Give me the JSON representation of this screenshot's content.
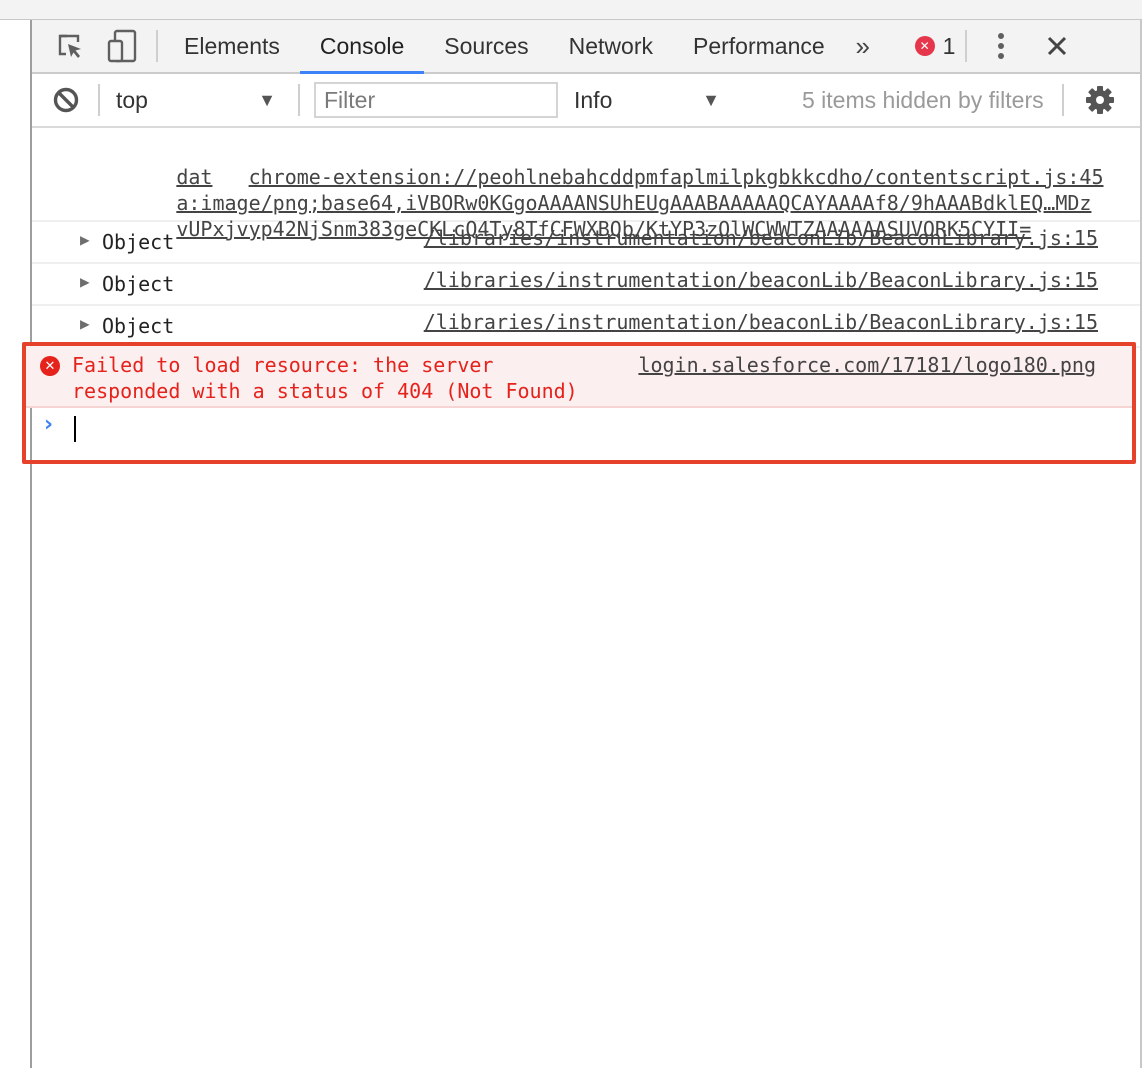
{
  "tabs": [
    {
      "label": "Elements",
      "active": false
    },
    {
      "label": "Console",
      "active": true
    },
    {
      "label": "Sources",
      "active": false
    },
    {
      "label": "Network",
      "active": false
    },
    {
      "label": "Performance",
      "active": false
    }
  ],
  "tabbar": {
    "more_tabs_icon": "»",
    "error_count": "1",
    "kebab_icon": "⋮",
    "close_icon": "✕"
  },
  "toolbar": {
    "context_select": "top",
    "filter_placeholder": "Filter",
    "filter_value": "",
    "level_select": "Info",
    "hidden_count": "5 items hidden by filters"
  },
  "messages": {
    "dataurl": {
      "line1_prefix": "dat",
      "line1_source": "chrome-extension://peohlnebahcddpmfaplmilpkgbkkcdho/contentscript.js:45",
      "line2": "a:image/png;base64,iVBORw0KGgoAAAANSUhEUgAAABAAAAAQCAYAAAAf8/9hAAABdklEQ…MDz",
      "line3": "vUPxjvyp42NjSnm383geCKLcQ4Ty8TfCFWXBQb/KtYP3zOlWCWWTZAAAAAASUVORK5CYII="
    },
    "objects": [
      {
        "label": "Object",
        "source": "/libraries/instrumentation/beaconLib/BeaconLibrary.js:15"
      },
      {
        "label": "Object",
        "source": "/libraries/instrumentation/beaconLib/BeaconLibrary.js:15"
      },
      {
        "label": "Object",
        "source": "/libraries/instrumentation/beaconLib/BeaconLibrary.js:15"
      }
    ],
    "error": {
      "line1": "Failed to load resource: the server",
      "line2": "responded with a status of 404 (Not Found)",
      "source": "login.salesforce.com/17181/logo180.png"
    }
  },
  "prompt": {
    "chevron": "›"
  },
  "colors": {
    "accent": "#3e82f7",
    "error": "#e5221b",
    "error_bg": "#fcefef",
    "highlight_border": "#e6412b"
  }
}
